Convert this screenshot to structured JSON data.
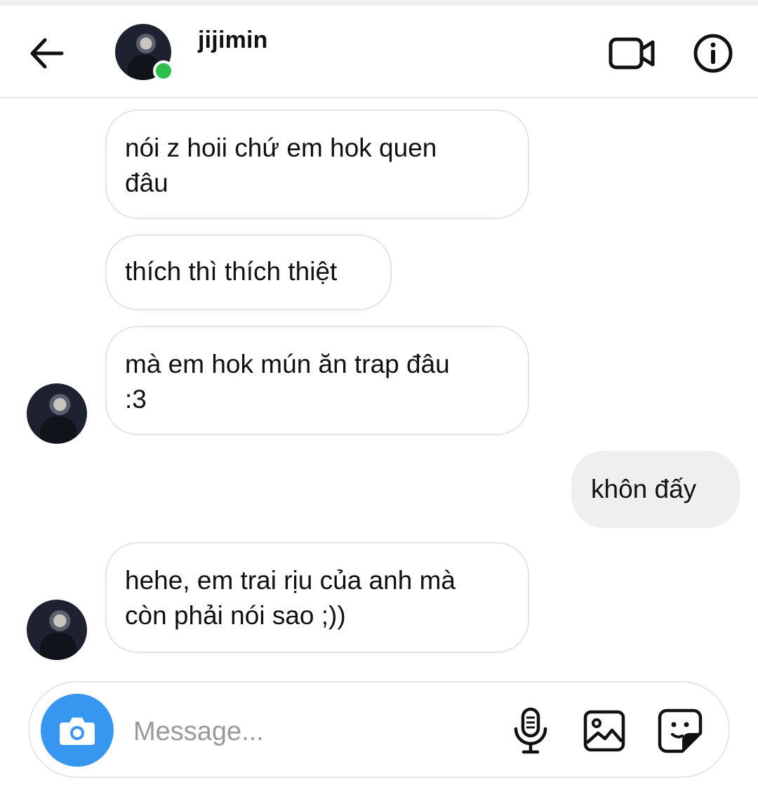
{
  "header": {
    "username": "jijimin",
    "icons": {
      "back": "back-arrow-icon",
      "video": "video-call-icon",
      "info": "info-icon"
    },
    "online": true,
    "online_color": "#2ec04f"
  },
  "messages": [
    {
      "direction": "in",
      "text": "nói z hoii chứ em hok quen\nđâu"
    },
    {
      "direction": "in",
      "text": "thích thì thích thiệt"
    },
    {
      "direction": "in",
      "text": "mà em hok mún ăn trap đâu\n:3",
      "show_avatar": true
    },
    {
      "direction": "out",
      "text": "khôn đấy"
    },
    {
      "direction": "in",
      "text": "hehe, em trai rịu của anh mà\ncòn phải nói sao ;))",
      "show_avatar": true
    }
  ],
  "composer": {
    "placeholder": "Message...",
    "value": "",
    "icons": {
      "camera": "camera-icon",
      "mic": "microphone-icon",
      "gallery": "image-gallery-icon",
      "sticker": "sticker-icon"
    },
    "accent": "#3797f0"
  },
  "colors": {
    "incoming_border": "#e4e4e4",
    "outgoing_bg": "#efefef"
  }
}
